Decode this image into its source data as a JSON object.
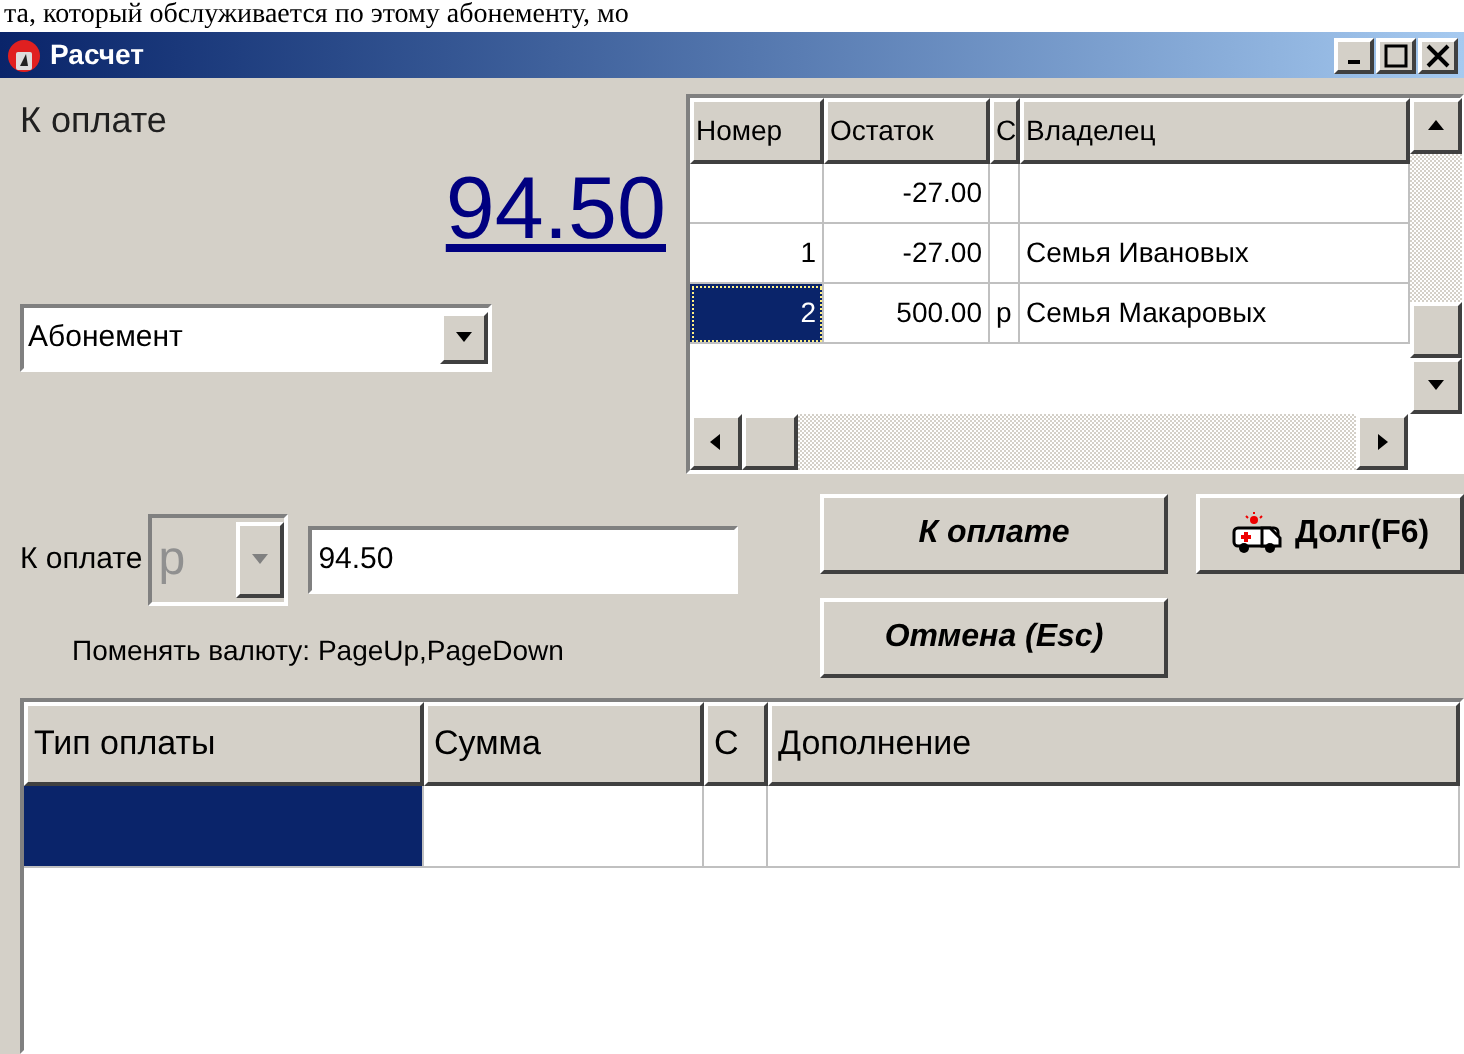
{
  "background_text": "та, который обслуживается по этому абонементу, мо",
  "window": {
    "title": "Расчет"
  },
  "amount": {
    "label": "К оплате",
    "value": "94.50"
  },
  "payment_type": {
    "value": "Абонемент"
  },
  "accounts": {
    "columns": [
      "Номер",
      "Остаток",
      "С",
      "Владелец"
    ],
    "rows": [
      {
        "cells": [
          "",
          "-27.00",
          "",
          ""
        ],
        "selected": false
      },
      {
        "cells": [
          "1",
          "-27.00",
          "",
          "Семья Ивановых"
        ],
        "selected": false
      },
      {
        "cells": [
          "2",
          "500.00",
          "р",
          "Семья Макаровых"
        ],
        "selected": true
      }
    ]
  },
  "payment": {
    "label": "К оплате",
    "currency": "р",
    "currency_disabled": true,
    "value": "94.50",
    "hint": "Поменять валюту: PageUp,PageDown"
  },
  "buttons": [
    {
      "label": "К оплате",
      "kind": "pay"
    },
    {
      "label": "Долг(F6)",
      "kind": "debt"
    },
    {
      "label": "Отмена (Esc)",
      "kind": "cancel"
    }
  ],
  "payments": {
    "columns": [
      "Тип оплаты",
      "Сумма",
      "С",
      "Дополнение"
    ],
    "rows": [
      {
        "cells": [
          {
            "selected": true
          },
          {
            "selected": false
          },
          {
            "selected": false
          },
          {
            "selected": false
          }
        ]
      }
    ]
  }
}
